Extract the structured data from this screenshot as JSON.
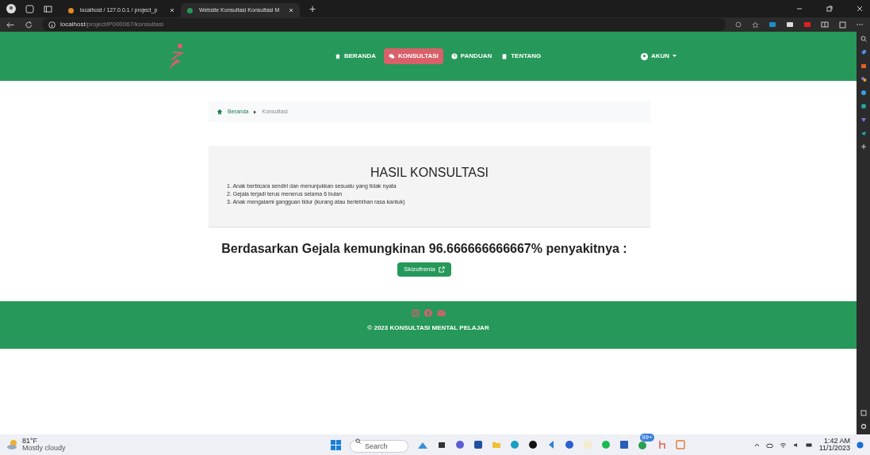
{
  "browser": {
    "tabs": [
      {
        "title": "localhost / 127.0.0.1 / project_p",
        "selected": false
      },
      {
        "title": "Website Konsultasi Konsultasi M",
        "selected": true
      }
    ],
    "new_tab": "+",
    "address": {
      "host": "localhost",
      "path": "/project/P000067/konsultasi"
    }
  },
  "navbar": {
    "items": [
      {
        "label": "BERANDA",
        "selected": false
      },
      {
        "label": "KONSULTASI",
        "selected": true
      },
      {
        "label": "PANDUAN",
        "selected": false
      },
      {
        "label": "TENTANG",
        "selected": false
      }
    ],
    "account": "AKUN"
  },
  "breadcrumb": {
    "home": "Beranda",
    "current": "Konsultasi"
  },
  "result": {
    "title": "HASIL KONSULTASI",
    "symptoms": [
      "1. Anak berbicara sendiri dan menunjukkan sesuatu yang tidak nyata",
      "2. Gejala terjadi terus menerus selama 6 bulan",
      "3. Anak mengalami gangguan tidur (kurang atau berlebihan rasa kantuk)"
    ],
    "conclusion": "Berdasarkan Gejala kemungkinan 96.666666666667% penyakitnya :",
    "disease": "Skizofrenia"
  },
  "footer": {
    "copyright": "© 2023 KONSULTASI MENTAL PELAJAR"
  },
  "taskbar": {
    "temperature": "81°F",
    "weather": "Mostly cloudy",
    "search_placeholder": "Search",
    "badge": "99+",
    "time": "1:42 AM",
    "date": "11/1/2023"
  }
}
